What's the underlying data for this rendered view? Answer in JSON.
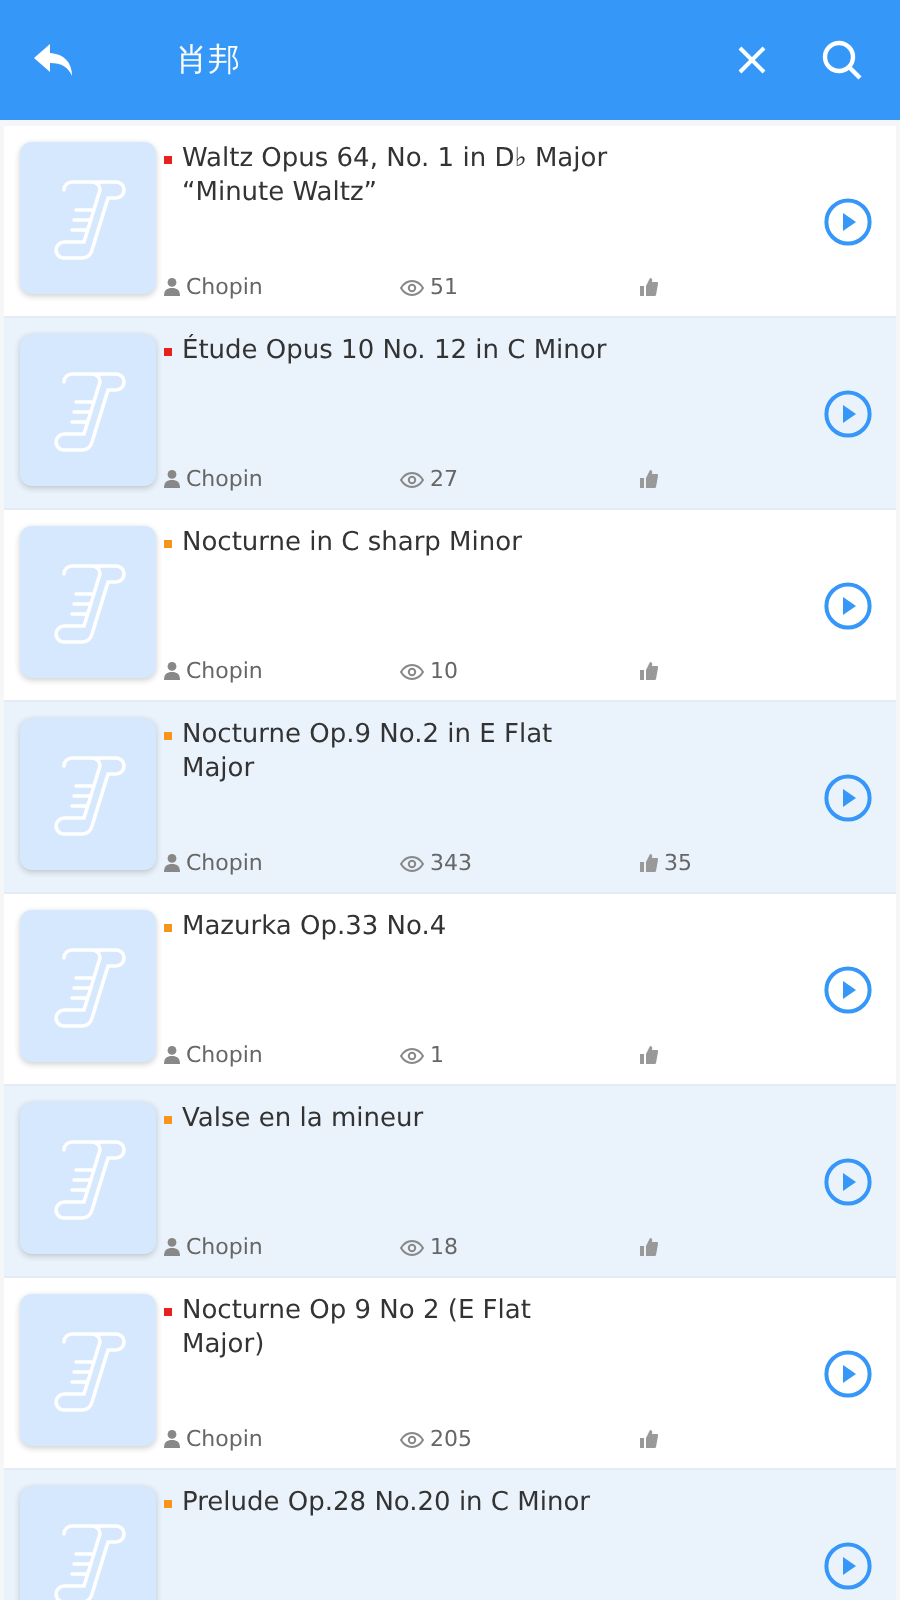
{
  "header": {
    "title": "肖邦"
  },
  "pieces": [
    {
      "title": "Waltz Opus 64, No. 1 in D♭ Major “Minute Waltz”",
      "color": "#e8211b",
      "composer": "Chopin",
      "views": "51"
    },
    {
      "title": "Étude Opus 10 No. 12 in C Minor",
      "color": "#e8211b",
      "composer": "Chopin",
      "views": "27"
    },
    {
      "title": "Nocturne in C sharp Minor",
      "color": "#f7941d",
      "composer": "Chopin",
      "views": "10"
    },
    {
      "title": "Nocturne Op.9 No.2 in E Flat Major",
      "color": "#f7941d",
      "composer": "Chopin",
      "views": "343",
      "likes": "35"
    },
    {
      "title": "Mazurka Op.33 No.4",
      "color": "#f7941d",
      "composer": "Chopin",
      "views": "1"
    },
    {
      "title": "Valse en la mineur",
      "color": "#f7941d",
      "composer": "Chopin",
      "views": "18"
    },
    {
      "title": "Nocturne Op 9 No 2 (E Flat Major)",
      "color": "#e8211b",
      "composer": "Chopin",
      "views": "205"
    },
    {
      "title": "Prelude Op.28 No.20 in C Minor",
      "color": "#f7941d"
    }
  ]
}
